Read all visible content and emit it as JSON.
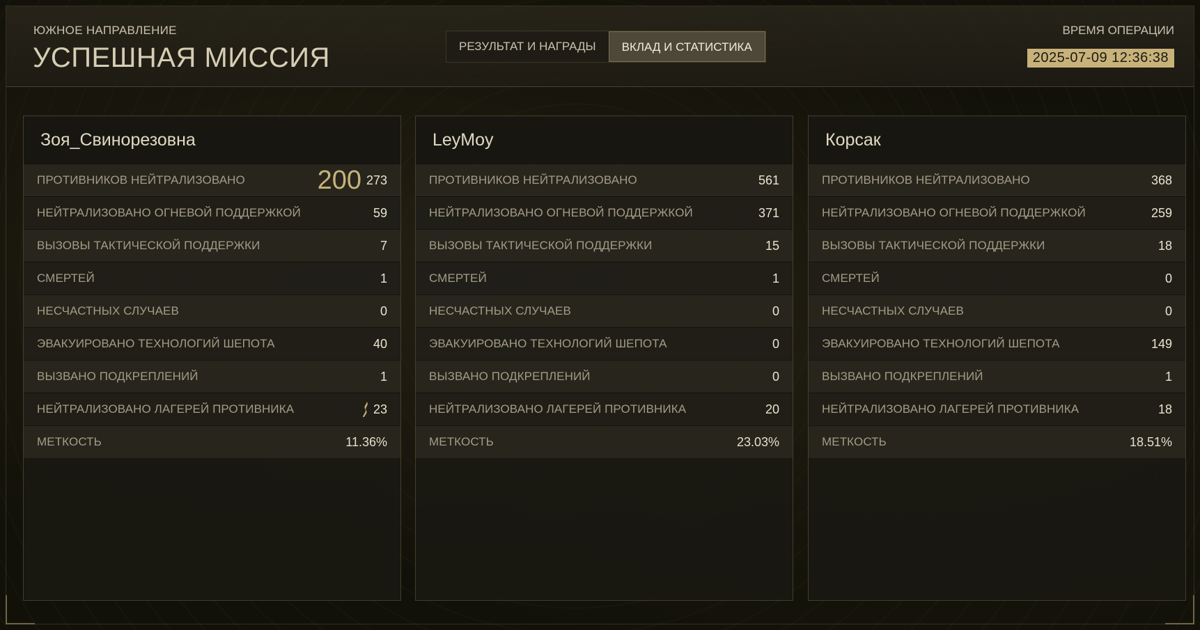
{
  "header": {
    "region": "ЮЖНОЕ НАПРАВЛЕНИЕ",
    "title": "УСПЕШНАЯ МИССИЯ",
    "tabs": [
      {
        "label": "РЕЗУЛЬТАТ И НАГРАДЫ",
        "active": false
      },
      {
        "label": "ВКЛАД И СТАТИСТИКА",
        "active": true
      }
    ],
    "op_time_label": "ВРЕМЯ ОПЕРАЦИИ",
    "op_time": "2025-07-09 12:36:38"
  },
  "labels": {
    "enemies": "ПРОТИВНИКОВ НЕЙТРАЛИЗОВАНО",
    "fire_support": "НЕЙТРАЛИЗОВАНО ОГНЕВОЙ ПОДДЕРЖКОЙ",
    "tactical": "ВЫЗОВЫ ТАКТИЧЕСКОЙ ПОДДЕРЖКИ",
    "deaths": "СМЕРТЕЙ",
    "accidents": "НЕСЧАСТНЫХ СЛУЧАЕВ",
    "whisper_tech": "ЭВАКУИРОВАНО ТЕХНОЛОГИЙ ШЕПОТА",
    "reinforcements": "ВЫЗВАНО ПОДКРЕПЛЕНИЙ",
    "camps": "НЕЙТРАЛИЗОВАНО ЛАГЕРЕЙ ПРОТИВНИКА",
    "accuracy": "МЕТКОСТЬ"
  },
  "players": [
    {
      "name": "Зоя_Свинорезовна",
      "enemies_overlay": "200",
      "enemies": "273",
      "fire_support": "59",
      "tactical": "7",
      "deaths": "1",
      "accidents": "0",
      "whisper_tech": "40",
      "reinforcements": "1",
      "camps": "23",
      "accuracy": "11.36%"
    },
    {
      "name": "LeyMoy",
      "enemies": "561",
      "fire_support": "371",
      "tactical": "15",
      "deaths": "1",
      "accidents": "0",
      "whisper_tech": "0",
      "reinforcements": "0",
      "camps": "20",
      "accuracy": "23.03%"
    },
    {
      "name": "Корсак",
      "enemies": "368",
      "fire_support": "259",
      "tactical": "18",
      "deaths": "0",
      "accidents": "0",
      "whisper_tech": "149",
      "reinforcements": "1",
      "camps": "18",
      "accuracy": "18.51%"
    }
  ],
  "colors": {
    "accent": "#c8b27a",
    "panel": "#1a1812",
    "text": "#eae4d0",
    "label": "#a39c86"
  },
  "icons": {
    "camp_marker": "flame-icon"
  }
}
